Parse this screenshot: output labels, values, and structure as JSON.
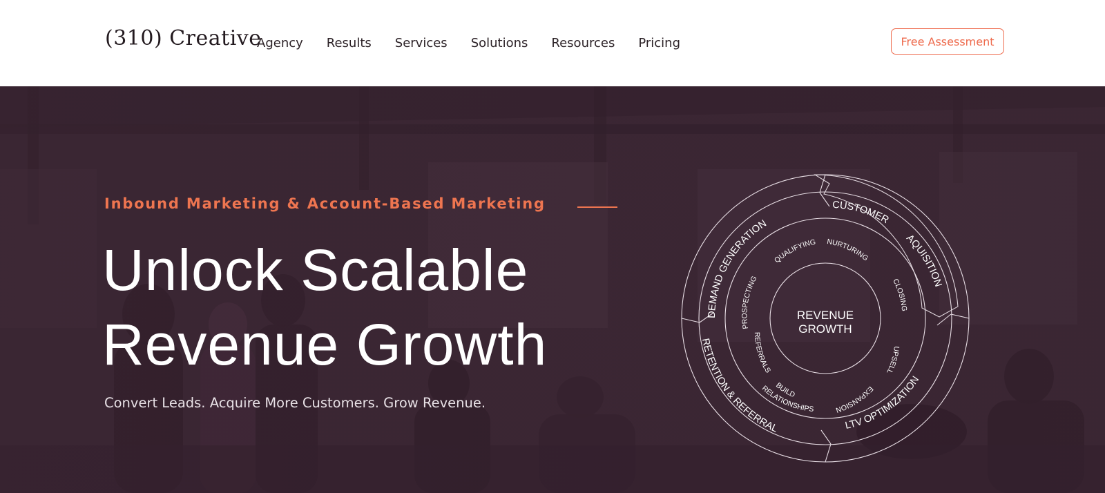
{
  "header": {
    "logo": "(310) Creative",
    "nav": [
      "Agency",
      "Results",
      "Services",
      "Solutions",
      "Resources",
      "Pricing"
    ],
    "cta_label": "Free Assessment"
  },
  "hero": {
    "eyebrow": "Inbound Marketing & Account-Based Marketing",
    "headline_line1": "Unlock Scalable",
    "headline_line2": "Revenue Growth",
    "subhead": "Convert Leads. Acquire More Customers. Grow Revenue."
  },
  "wheel": {
    "center_line1": "REVENUE",
    "center_line2": "GROWTH",
    "outer": {
      "demand": "DEMAND GENERATION",
      "customer": "CUSTOMER",
      "aquisition": "AQUISITION",
      "ltv": "LTV OPTIMIZATION",
      "retention": "RETENTION & REFERRAL"
    },
    "inner": {
      "prospecting": "PROSPECTING",
      "qualifying": "QUALIFYING",
      "nurturing": "NURTURING",
      "closing": "CLOSING",
      "upsell": "UPSELL",
      "expansion": "EXPANSION",
      "build": "BUILD",
      "relationships": "RELATIONSHIPS",
      "referrals": "REFERRALS"
    }
  },
  "colors": {
    "accent": "#ee6a4c",
    "hero_bg": "#3a2633",
    "text_dark": "#2b2126"
  }
}
